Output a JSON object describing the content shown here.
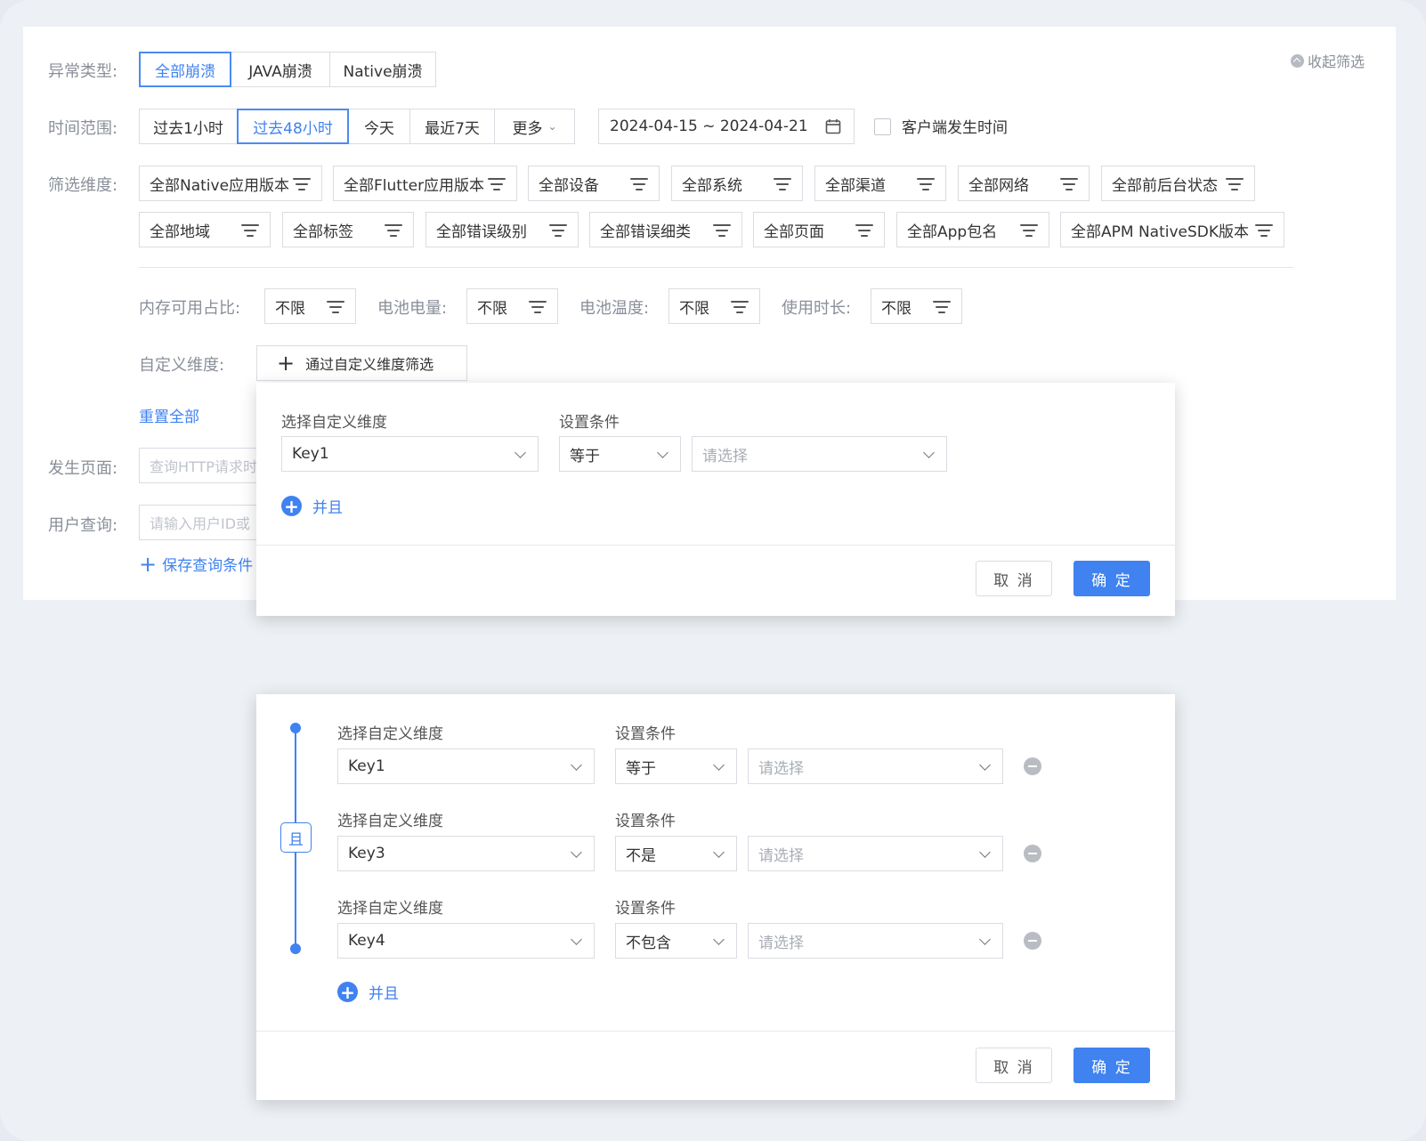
{
  "filters": {
    "collapse_label": "收起筛选",
    "exception_type": {
      "label": "异常类型:",
      "options": [
        "全部崩溃",
        "JAVA崩溃",
        "Native崩溃"
      ],
      "selected": "全部崩溃"
    },
    "time_range": {
      "label": "时间范围:",
      "options": [
        "过去1小时",
        "过去48小时",
        "今天",
        "最近7天",
        "更多"
      ],
      "selected": "过去48小时",
      "date_range": "2024-04-15 ~ 2024-04-21",
      "client_time_label": "客户端发生时间"
    },
    "dimensions": {
      "label": "筛选维度:",
      "chips": [
        "全部Native应用版本",
        "全部Flutter应用版本",
        "全部设备",
        "全部系统",
        "全部渠道",
        "全部网络",
        "全部前后台状态",
        "全部地域",
        "全部标签",
        "全部错误级别",
        "全部错误细类",
        "全部页面",
        "全部App包名",
        "全部APM NativeSDK版本"
      ]
    },
    "metrics": [
      {
        "label": "内存可用占比:",
        "value": "不限"
      },
      {
        "label": "电池电量:",
        "value": "不限"
      },
      {
        "label": "电池温度:",
        "value": "不限"
      },
      {
        "label": "使用时长:",
        "value": "不限"
      }
    ],
    "custom": {
      "label": "自定义维度:",
      "button": "通过自定义维度筛选"
    },
    "reset_all": "重置全部",
    "page": {
      "label": "发生页面:",
      "placeholder": "查询HTTP请求时"
    },
    "user": {
      "label": "用户查询:",
      "placeholder": "请输入用户ID或"
    },
    "save_query": "保存查询条件"
  },
  "popup1": {
    "dim_label": "选择自定义维度",
    "cond_label": "设置条件",
    "dim_value": "Key1",
    "cond_value": "等于",
    "value_placeholder": "请选择",
    "add_label": "并且",
    "cancel": "取 消",
    "ok": "确 定"
  },
  "popup2": {
    "and_tag": "且",
    "rows": [
      {
        "dim_label": "选择自定义维度",
        "cond_label": "设置条件",
        "dim_value": "Key1",
        "cond_value": "等于",
        "value_placeholder": "请选择"
      },
      {
        "dim_label": "选择自定义维度",
        "cond_label": "设置条件",
        "dim_value": "Key3",
        "cond_value": "不是",
        "value_placeholder": "请选择"
      },
      {
        "dim_label": "选择自定义维度",
        "cond_label": "设置条件",
        "dim_value": "Key4",
        "cond_value": "不包含",
        "value_placeholder": "请选择"
      }
    ],
    "add_label": "并且",
    "cancel": "取 消",
    "ok": "确 定"
  },
  "colors": {
    "accent": "#3f82f0",
    "border": "#d9dce1",
    "label": "#8a8f99"
  }
}
